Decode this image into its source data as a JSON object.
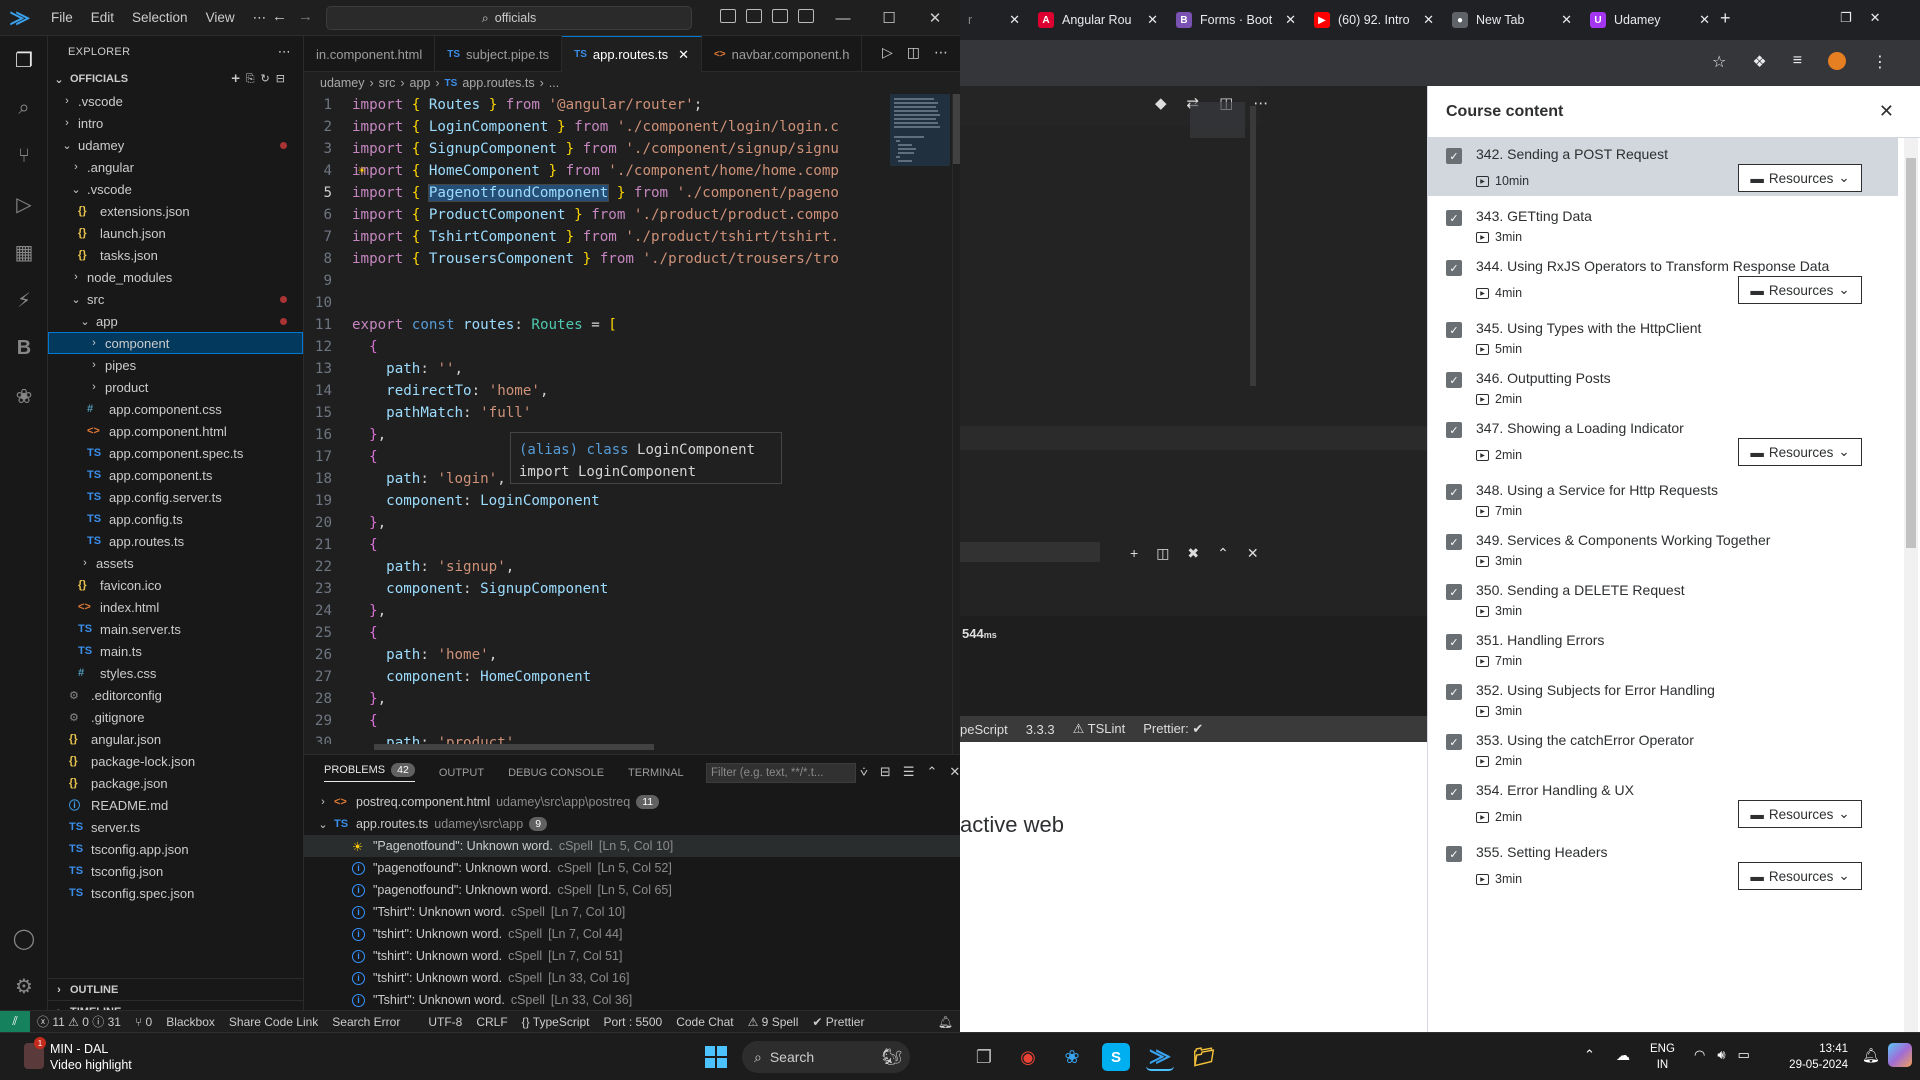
{
  "vscode": {
    "menu": [
      "File",
      "Edit",
      "Selection",
      "View",
      "⋯"
    ],
    "search": "officials",
    "explorer": {
      "title": "EXPLORER",
      "root": "OFFICIALS",
      "tree": [
        {
          "d": 0,
          "kind": "folder",
          "open": false,
          "label": ".vscode"
        },
        {
          "d": 0,
          "kind": "folder",
          "open": false,
          "label": "intro"
        },
        {
          "d": 0,
          "kind": "folder",
          "open": true,
          "label": "udamey",
          "dot": true
        },
        {
          "d": 1,
          "kind": "folder",
          "open": false,
          "label": ".angular"
        },
        {
          "d": 1,
          "kind": "folder",
          "open": true,
          "label": ".vscode"
        },
        {
          "d": 2,
          "kind": "json",
          "label": "extensions.json"
        },
        {
          "d": 2,
          "kind": "json",
          "label": "launch.json"
        },
        {
          "d": 2,
          "kind": "json",
          "label": "tasks.json"
        },
        {
          "d": 1,
          "kind": "folder",
          "open": false,
          "label": "node_modules"
        },
        {
          "d": 1,
          "kind": "folder",
          "open": true,
          "label": "src",
          "dot": true
        },
        {
          "d": 2,
          "kind": "folder",
          "open": true,
          "label": "app",
          "dot": true
        },
        {
          "d": 3,
          "kind": "folder",
          "open": false,
          "label": "component",
          "selected": true
        },
        {
          "d": 3,
          "kind": "folder",
          "open": false,
          "label": "pipes"
        },
        {
          "d": 3,
          "kind": "folder",
          "open": false,
          "label": "product"
        },
        {
          "d": 3,
          "kind": "css",
          "label": "app.component.css"
        },
        {
          "d": 3,
          "kind": "html",
          "label": "app.component.html"
        },
        {
          "d": 3,
          "kind": "ts",
          "label": "app.component.spec.ts"
        },
        {
          "d": 3,
          "kind": "ts",
          "label": "app.component.ts"
        },
        {
          "d": 3,
          "kind": "ts",
          "label": "app.config.server.ts"
        },
        {
          "d": 3,
          "kind": "ts",
          "label": "app.config.ts"
        },
        {
          "d": 3,
          "kind": "ts",
          "label": "app.routes.ts"
        },
        {
          "d": 2,
          "kind": "folder",
          "open": false,
          "label": "assets"
        },
        {
          "d": 2,
          "kind": "json",
          "label": "favicon.ico"
        },
        {
          "d": 2,
          "kind": "html",
          "label": "index.html"
        },
        {
          "d": 2,
          "kind": "ts",
          "label": "main.server.ts"
        },
        {
          "d": 2,
          "kind": "ts",
          "label": "main.ts"
        },
        {
          "d": 2,
          "kind": "css",
          "label": "styles.css"
        },
        {
          "d": 1,
          "kind": "gear",
          "label": ".editorconfig"
        },
        {
          "d": 1,
          "kind": "gear",
          "label": ".gitignore"
        },
        {
          "d": 1,
          "kind": "json",
          "label": "angular.json"
        },
        {
          "d": 1,
          "kind": "json",
          "label": "package-lock.json"
        },
        {
          "d": 1,
          "kind": "json",
          "label": "package.json"
        },
        {
          "d": 1,
          "kind": "md",
          "label": "README.md"
        },
        {
          "d": 1,
          "kind": "ts",
          "label": "server.ts"
        },
        {
          "d": 1,
          "kind": "ts",
          "label": "tsconfig.app.json"
        },
        {
          "d": 1,
          "kind": "ts",
          "label": "tsconfig.json"
        },
        {
          "d": 1,
          "kind": "ts",
          "label": "tsconfig.spec.json"
        }
      ],
      "outline": "OUTLINE",
      "timeline": "TIMELINE"
    },
    "tabs": [
      {
        "label": "in.component.html",
        "kind": "html",
        "active": false
      },
      {
        "label": "subject.pipe.ts",
        "kind": "ts",
        "active": false
      },
      {
        "label": "app.routes.ts",
        "kind": "ts",
        "active": true
      },
      {
        "label": "navbar.component.h",
        "kind": "html",
        "active": false
      }
    ],
    "breadcrumb": [
      "udamey",
      "src",
      "app",
      "app.routes.ts",
      "..."
    ],
    "hover": {
      "line1_kw": "(alias) ",
      "line1_kw2": "class",
      "line1_name": " LoginComponent",
      "line2": "import LoginComponent"
    },
    "panel": {
      "tabs": [
        "PROBLEMS",
        "OUTPUT",
        "DEBUG CONSOLE",
        "TERMINAL"
      ],
      "problems_count": "42",
      "filter_placeholder": "Filter (e.g. text, **/*.t...",
      "groups": [
        {
          "file": "postreq.component.html",
          "path": "udamey\\src\\app\\postreq",
          "count": "11",
          "open": false
        },
        {
          "file": "app.routes.ts",
          "path": "udamey\\src\\app",
          "count": "9",
          "open": true
        }
      ],
      "problems": [
        {
          "msg": "\"Pagenotfound\": Unknown word.",
          "src": "cSpell",
          "loc": "[Ln 5, Col 10]",
          "bulb": true
        },
        {
          "msg": "\"pagenotfound\": Unknown word.",
          "src": "cSpell",
          "loc": "[Ln 5, Col 52]"
        },
        {
          "msg": "\"pagenotfound\": Unknown word.",
          "src": "cSpell",
          "loc": "[Ln 5, Col 65]"
        },
        {
          "msg": "\"Tshirt\": Unknown word.",
          "src": "cSpell",
          "loc": "[Ln 7, Col 10]"
        },
        {
          "msg": "\"tshirt\": Unknown word.",
          "src": "cSpell",
          "loc": "[Ln 7, Col 44]"
        },
        {
          "msg": "\"tshirt\": Unknown word.",
          "src": "cSpell",
          "loc": "[Ln 7, Col 51]"
        },
        {
          "msg": "\"tshirt\": Unknown word.",
          "src": "cSpell",
          "loc": "[Ln 33, Col 16]"
        },
        {
          "msg": "\"Tshirt\": Unknown word.",
          "src": "cSpell",
          "loc": "[Ln 33, Col 36]"
        }
      ]
    },
    "status": {
      "errors": "11",
      "warnings": "0",
      "infos": "31",
      "ports": "0",
      "items": [
        "Blackbox",
        "Share Code Link",
        "Search Error",
        "UTF-8",
        "CRLF",
        "{} TypeScript",
        "Port : 5500",
        "Code Chat",
        "⚠ 9 Spell",
        "✔ Prettier"
      ]
    }
  },
  "browser": {
    "tabs": [
      {
        "label": "Angular Rou",
        "color": "#dd0031",
        "icon": "A"
      },
      {
        "label": "Forms · Boot",
        "color": "#7952b3",
        "icon": "B"
      },
      {
        "label": "(60) 92. Intro",
        "color": "#ff0000",
        "icon": "▶"
      },
      {
        "label": "New Tab",
        "color": "#5f6368",
        "icon": "●"
      },
      {
        "label": "Udamey",
        "color": "#a435f0",
        "icon": "U"
      }
    ],
    "video_bg_text": "active web",
    "video_bits": {
      "ms": "544",
      "lang": "peScript",
      "ver": "3.3.3",
      "lint": "TSLint",
      "prettier": "Prettier:"
    },
    "course": {
      "title": "Course content",
      "resources_label": "Resources",
      "lessons": [
        {
          "title": "342. Sending a POST Request",
          "dur": "10min",
          "res": true,
          "current": true
        },
        {
          "title": "343. GETting Data",
          "dur": "3min",
          "res": false
        },
        {
          "title": "344. Using RxJS Operators to Transform Response Data",
          "dur": "4min",
          "res": true
        },
        {
          "title": "345. Using Types with the HttpClient",
          "dur": "5min",
          "res": false
        },
        {
          "title": "346. Outputting Posts",
          "dur": "2min",
          "res": false
        },
        {
          "title": "347. Showing a Loading Indicator",
          "dur": "2min",
          "res": true
        },
        {
          "title": "348. Using a Service for Http Requests",
          "dur": "7min",
          "res": false
        },
        {
          "title": "349. Services & Components Working Together",
          "dur": "3min",
          "res": false
        },
        {
          "title": "350. Sending a DELETE Request",
          "dur": "3min",
          "res": false
        },
        {
          "title": "351. Handling Errors",
          "dur": "7min",
          "res": false
        },
        {
          "title": "352. Using Subjects for Error Handling",
          "dur": "3min",
          "res": false
        },
        {
          "title": "353. Using the catchError Operator",
          "dur": "2min",
          "res": false
        },
        {
          "title": "354. Error Handling & UX",
          "dur": "2min",
          "res": true
        },
        {
          "title": "355. Setting Headers",
          "dur": "3min",
          "res": true
        }
      ]
    }
  },
  "taskbar": {
    "weather_title": "MIN - DAL",
    "weather_sub": "Video highlight",
    "search": "Search",
    "lang": "ENG",
    "region": "IN",
    "time": "13:41",
    "date": "29-05-2024"
  }
}
